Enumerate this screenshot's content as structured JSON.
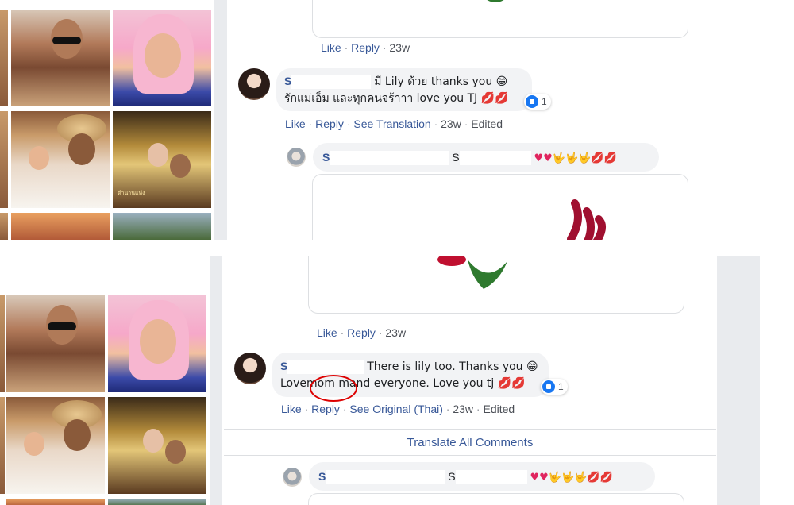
{
  "top": {
    "prev_actions": {
      "like": "Like",
      "reply": "Reply",
      "time": "23w"
    },
    "comment": {
      "name_initial": "S",
      "line1": "มี Lily ด้วย thanks you 😁",
      "line2": "รักแม่เอ็ม และทุกคนจร้าาา love you TJ 💋💋",
      "reaction_count": "1",
      "actions": {
        "like": "Like",
        "reply": "Reply",
        "translation": "See Translation",
        "time": "23w",
        "edited": "Edited"
      }
    },
    "reply": {
      "name_initial": "S",
      "name2_initial": "S",
      "emojis": "♥♥🤟🤟🤟💋💋"
    }
  },
  "bottom": {
    "prev_actions": {
      "like": "Like",
      "reply": "Reply",
      "time": "23w"
    },
    "comment": {
      "name_initial": "S",
      "line1": "There is lily too. Thanks you 😁",
      "line2_pre": "Love",
      "line2_mark": "mom m",
      "line2_post": "and everyone. Love you tj 💋💋",
      "reaction_count": "1",
      "actions": {
        "like": "Like",
        "reply": "Reply",
        "original": "See Original (Thai)",
        "time": "23w",
        "edited": "Edited"
      }
    },
    "translate_all": "Translate All Comments",
    "reply": {
      "name_initial": "S",
      "name2_initial": "S",
      "emojis": "♥♥🤟🤟🤟💋💋"
    }
  },
  "colors": {
    "link": "#385898",
    "bubble": "#f2f3f5",
    "like_blue": "#1877f2",
    "annotation": "#dd0000"
  }
}
